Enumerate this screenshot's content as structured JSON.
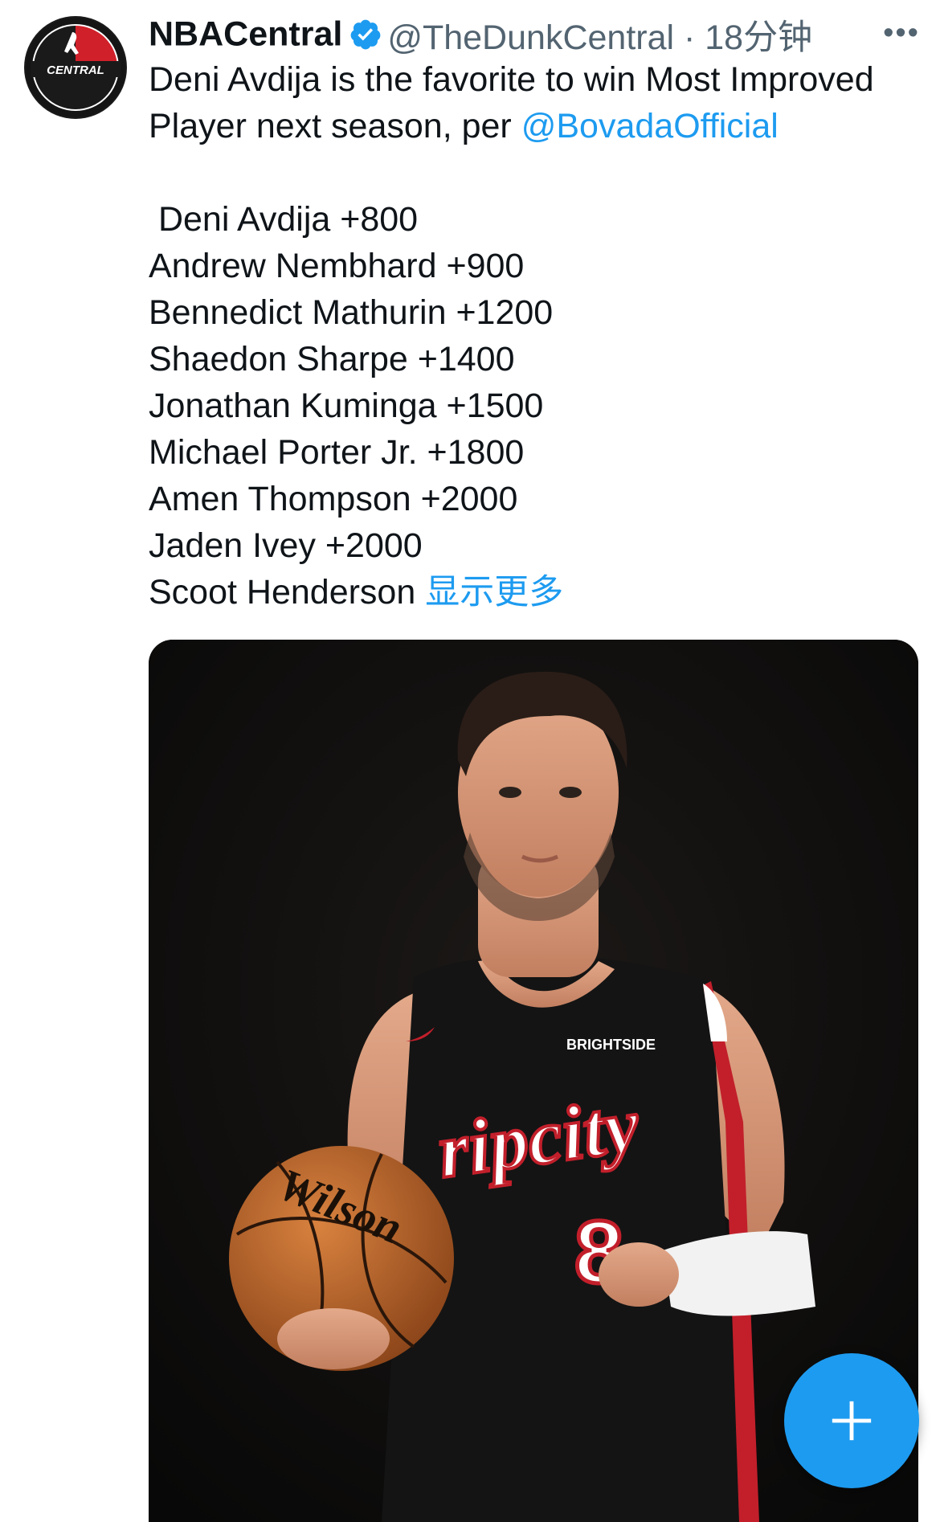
{
  "tweet": {
    "author_name": "NBACentral",
    "handle_line": "@TheDunkCentral · 18分钟",
    "text_line1": "Deni Avdija is the favorite to win Most Improved",
    "text_line2_prefix": "Player next season, per ",
    "mention": "@BovadaOfficial",
    "odds": [
      " Deni Avdija +800",
      "Andrew Nembhard +900",
      "Bennedict Mathurin +1200",
      "Shaedon Sharpe +1400",
      "Jonathan Kuminga +1500",
      "Michael Porter Jr. +1800",
      "Amen Thompson +2000",
      "Jaden Ivey +2000"
    ],
    "truncated_line": "Scoot Henderson ",
    "show_more": "显示更多",
    "more_icon": "more-horizontal-icon",
    "verified_icon": "verified-badge-icon"
  },
  "avatar": {
    "logo_text": "CENTRAL"
  },
  "media": {
    "jersey_wordmark": "ripcity",
    "jersey_number": "8",
    "sponsor": "BRIGHTSIDE",
    "ball_brand": "Wilson"
  },
  "fab": {
    "icon": "plus-icon"
  },
  "colors": {
    "link": "#1d9bf0",
    "fab": "#1d9bf0",
    "text": "#0f1419",
    "secondary": "#536471"
  }
}
